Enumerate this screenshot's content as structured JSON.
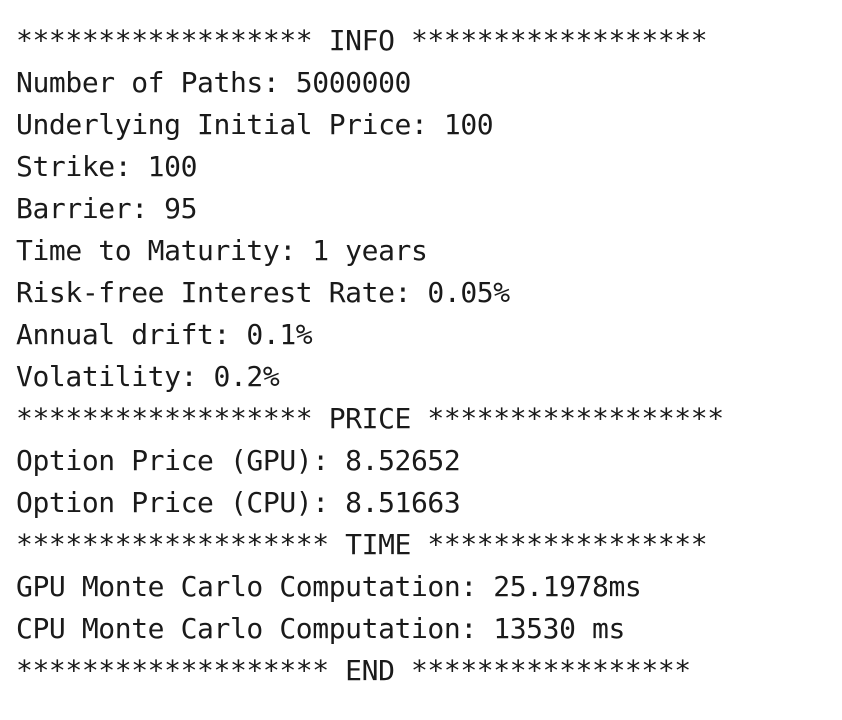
{
  "lines": [
    "****************** INFO ******************",
    "Number of Paths: 5000000",
    "Underlying Initial Price: 100",
    "Strike: 100",
    "Barrier: 95",
    "Time to Maturity: 1 years",
    "Risk-free Interest Rate: 0.05%",
    "Annual drift: 0.1%",
    "Volatility: 0.2%",
    "****************** PRICE ******************",
    "Option Price (GPU): 8.52652",
    "Option Price (CPU): 8.51663",
    "******************* TIME *****************",
    "GPU Monte Carlo Computation: 25.1978ms",
    "CPU Monte Carlo Computation: 13530 ms",
    "******************* END *****************"
  ]
}
